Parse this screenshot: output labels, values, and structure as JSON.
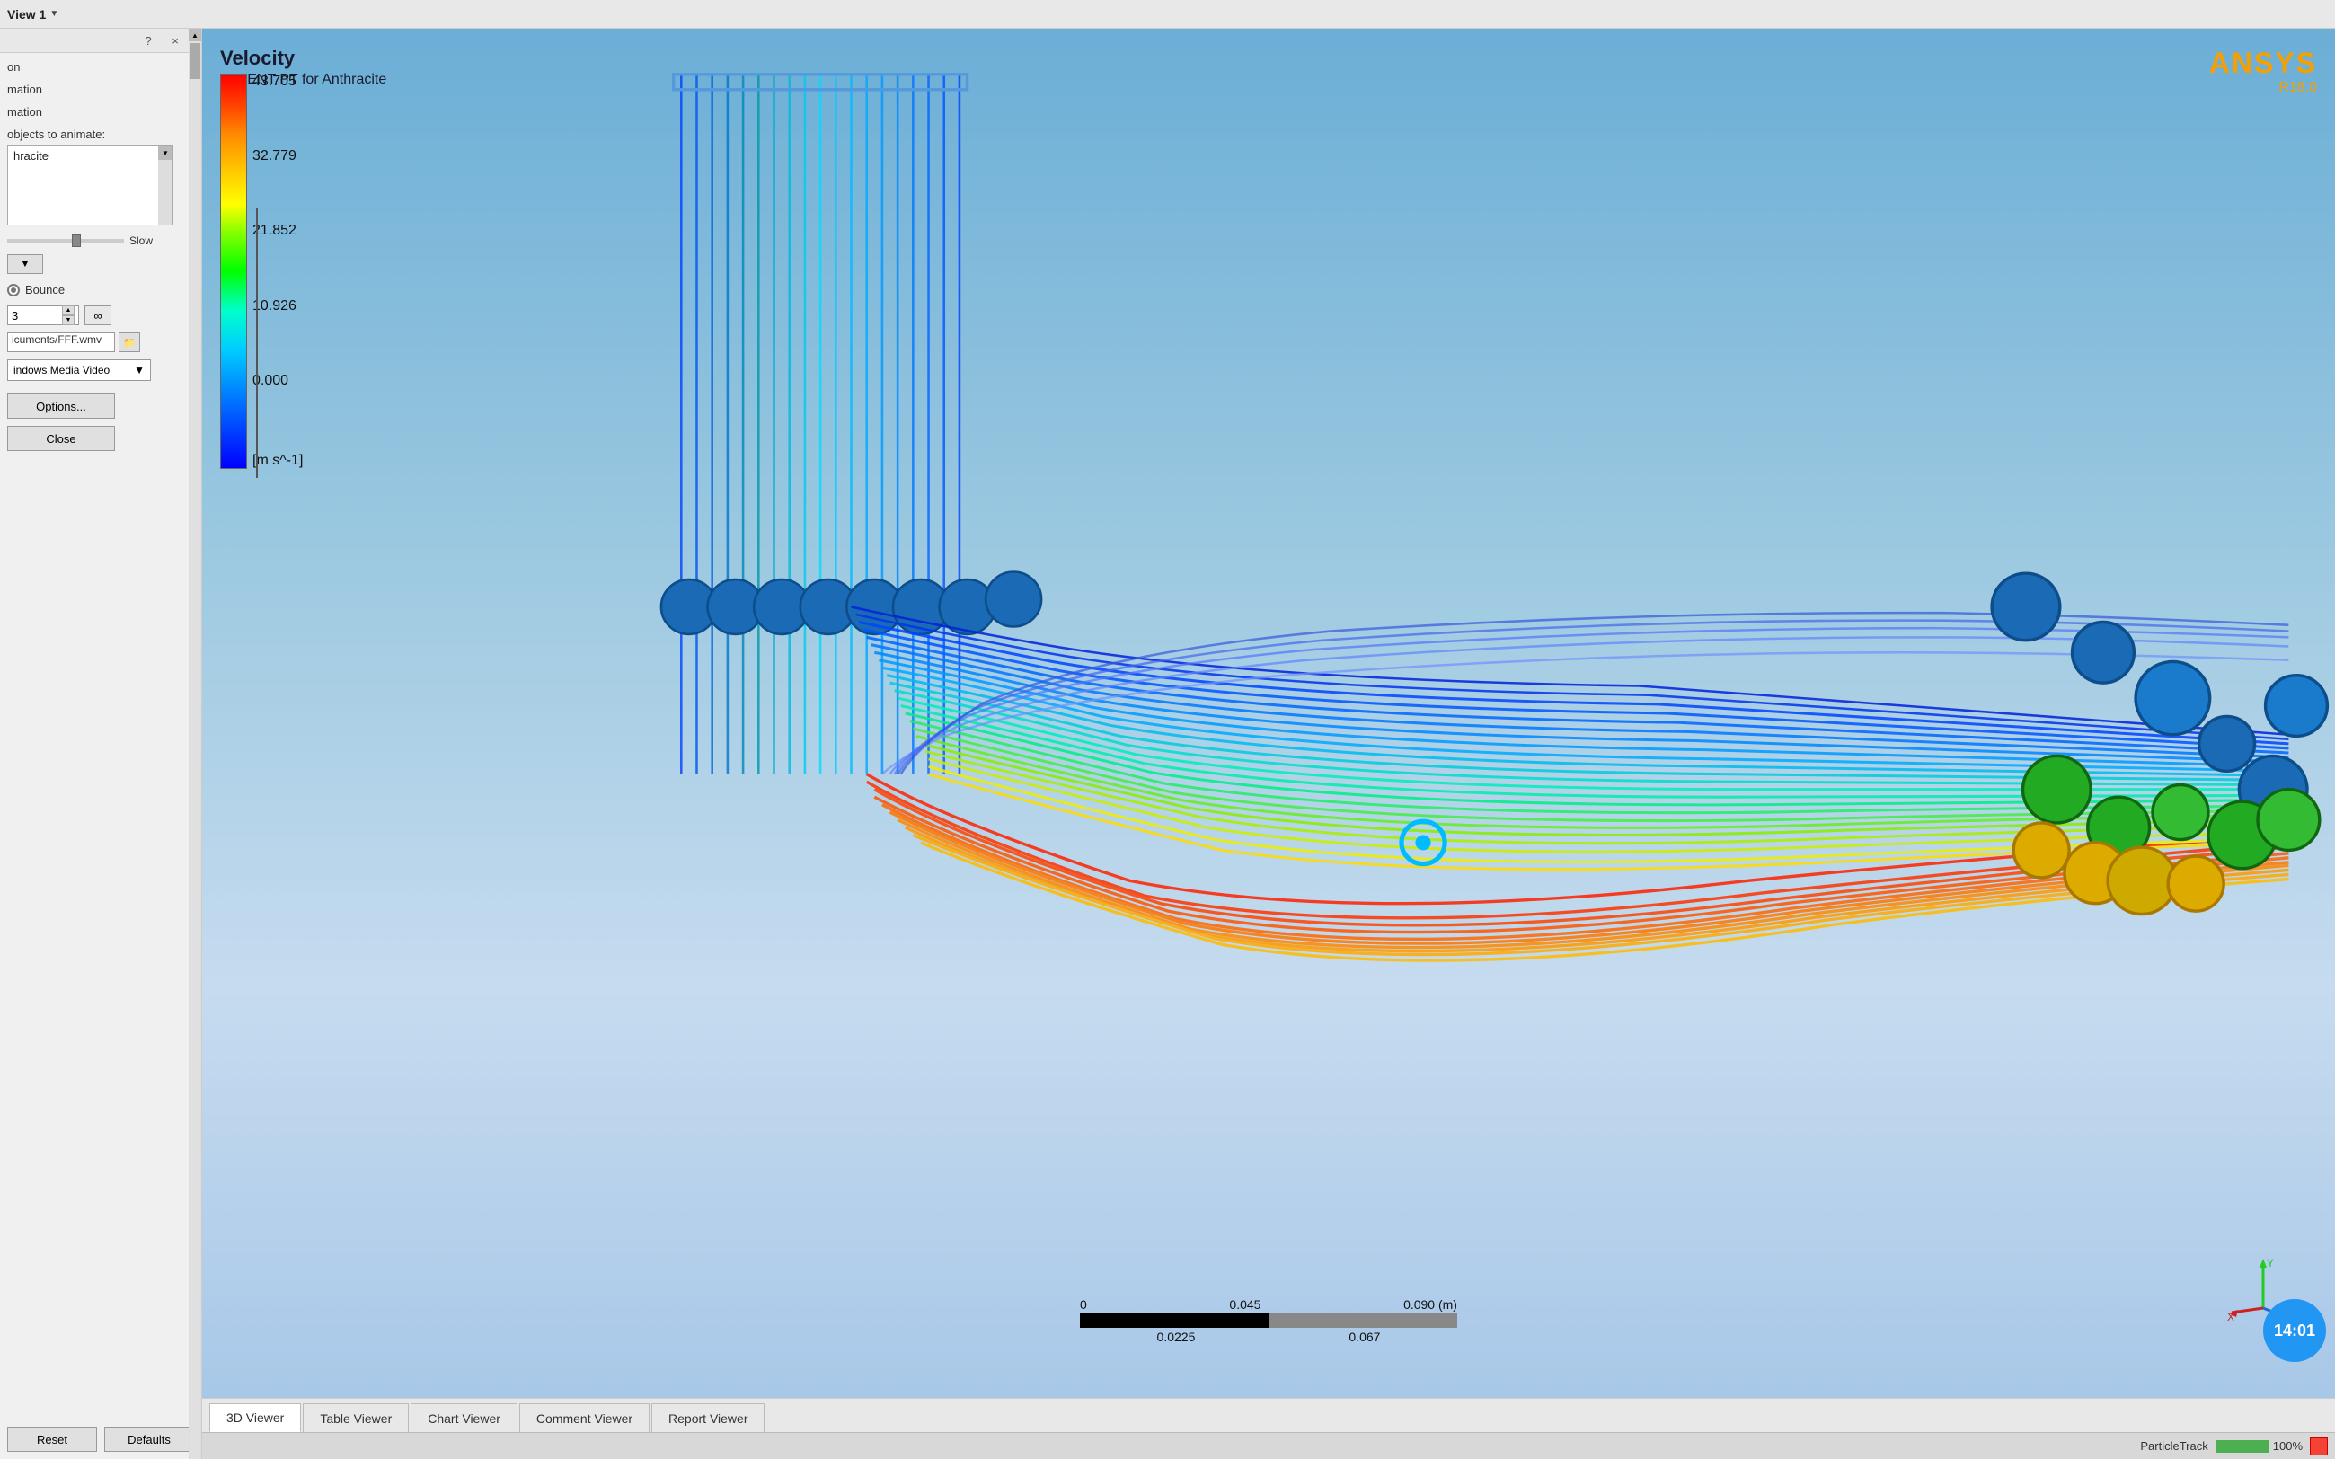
{
  "topbar": {
    "view_label": "View 1",
    "dropdown_arrow": "▼"
  },
  "panel": {
    "help_label": "?",
    "close_label": "×",
    "section1_label": "on",
    "section2_label": "mation",
    "section3_label": "mation",
    "objects_label": "objects to animate:",
    "objects_item": "hracite",
    "slider_label": "Slow",
    "bounce_label": "Bounce",
    "spinbox_value": "3",
    "infinity_label": "∞",
    "file_value": "icuments/FFF.wmv",
    "format_label": "indows Media Video",
    "options_label": "Options...",
    "close_dialog_label": "Close",
    "reset_label": "Reset",
    "defaults_label": "Defaults"
  },
  "viewport": {
    "title": "Velocity",
    "subtitle": "FLUENT PT for Anthracite",
    "ansys_name": "ANSYS",
    "ansys_version": "R18.0"
  },
  "color_scale": {
    "values": [
      "43.705",
      "32.779",
      "21.852",
      "10.926",
      "0.000"
    ],
    "unit": "[m s^-1]"
  },
  "scale_bar": {
    "top_values": [
      "0",
      "0.045",
      "0.090 (m)"
    ],
    "bottom_values": [
      "0.0225",
      "0.067"
    ]
  },
  "tabs": [
    {
      "label": "3D Viewer",
      "active": true
    },
    {
      "label": "Table Viewer",
      "active": false
    },
    {
      "label": "Chart Viewer",
      "active": false
    },
    {
      "label": "Comment Viewer",
      "active": false
    },
    {
      "label": "Report Viewer",
      "active": false
    }
  ],
  "status_bar": {
    "item_label": "ParticleTrack",
    "percent": "100%"
  },
  "timer": {
    "display": "14:01"
  },
  "colors": {
    "accent_orange": "#f5a000",
    "background_gradient_top": "#6baed6",
    "background_gradient_bottom": "#c6dbef"
  }
}
